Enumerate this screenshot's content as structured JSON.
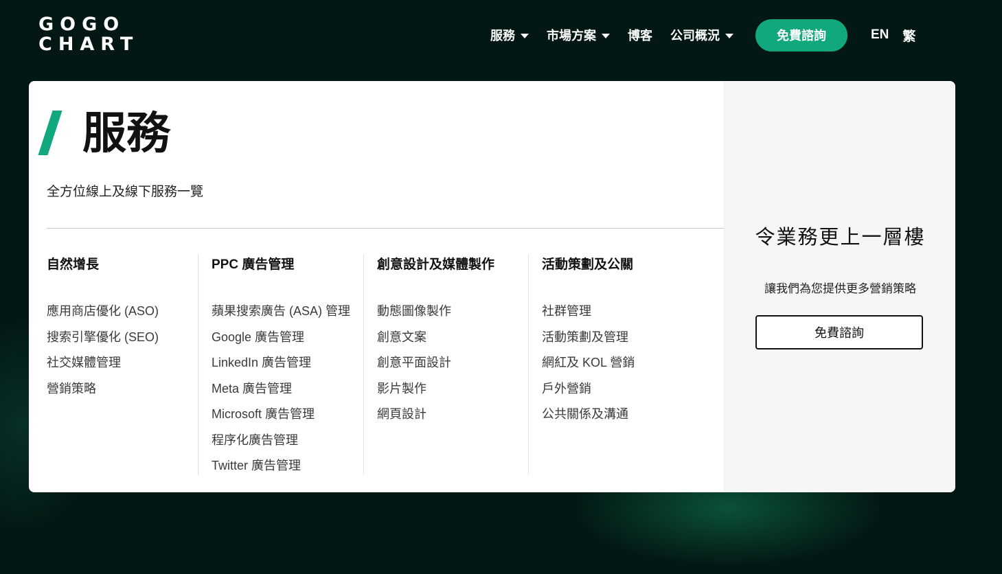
{
  "brand": {
    "logo_line1": "GOGO",
    "logo_line2": "CHART"
  },
  "nav": {
    "items": [
      {
        "label": "服務",
        "icon": "caret-down-icon"
      },
      {
        "label": "市場方案",
        "icon": "caret-down-icon"
      },
      {
        "label": "博客"
      },
      {
        "label": "公司概況",
        "icon": "caret-down-icon"
      }
    ],
    "cta_label": "免費諮詢",
    "lang_en": "EN",
    "lang_zh": "繁"
  },
  "menu": {
    "title": "服務",
    "subtitle": "全方位線上及線下服務一覽",
    "columns": [
      {
        "heading": "自然增長",
        "items": [
          "應用商店優化 (ASO)",
          "搜索引擎優化 (SEO)",
          "社交媒體管理",
          "營銷策略"
        ]
      },
      {
        "heading": "PPC 廣告管理",
        "items": [
          "蘋果搜索廣告 (ASA) 管理",
          "Google 廣告管理",
          "LinkedIn 廣告管理",
          "Meta 廣告管理",
          "Microsoft 廣告管理",
          "程序化廣告管理",
          "Twitter 廣告管理"
        ]
      },
      {
        "heading": "創意設計及媒體製作",
        "items": [
          "動態圖像製作",
          "創意文案",
          "創意平面設計",
          "影片製作",
          "網頁設計"
        ]
      },
      {
        "heading": "活動策劃及公關",
        "items": [
          "社群管理",
          "活動策劃及管理",
          "網紅及 KOL 營銷",
          "戶外營銷",
          "公共關係及溝通"
        ]
      }
    ]
  },
  "side": {
    "title": "令業務更上一層樓",
    "text": "讓我們為您提供更多營銷策略",
    "button_label": "免費諮詢"
  },
  "colors": {
    "background": "#031814",
    "accent": "#11a87d",
    "panel": "#ffffff",
    "side_panel": "#f6f6f6"
  }
}
